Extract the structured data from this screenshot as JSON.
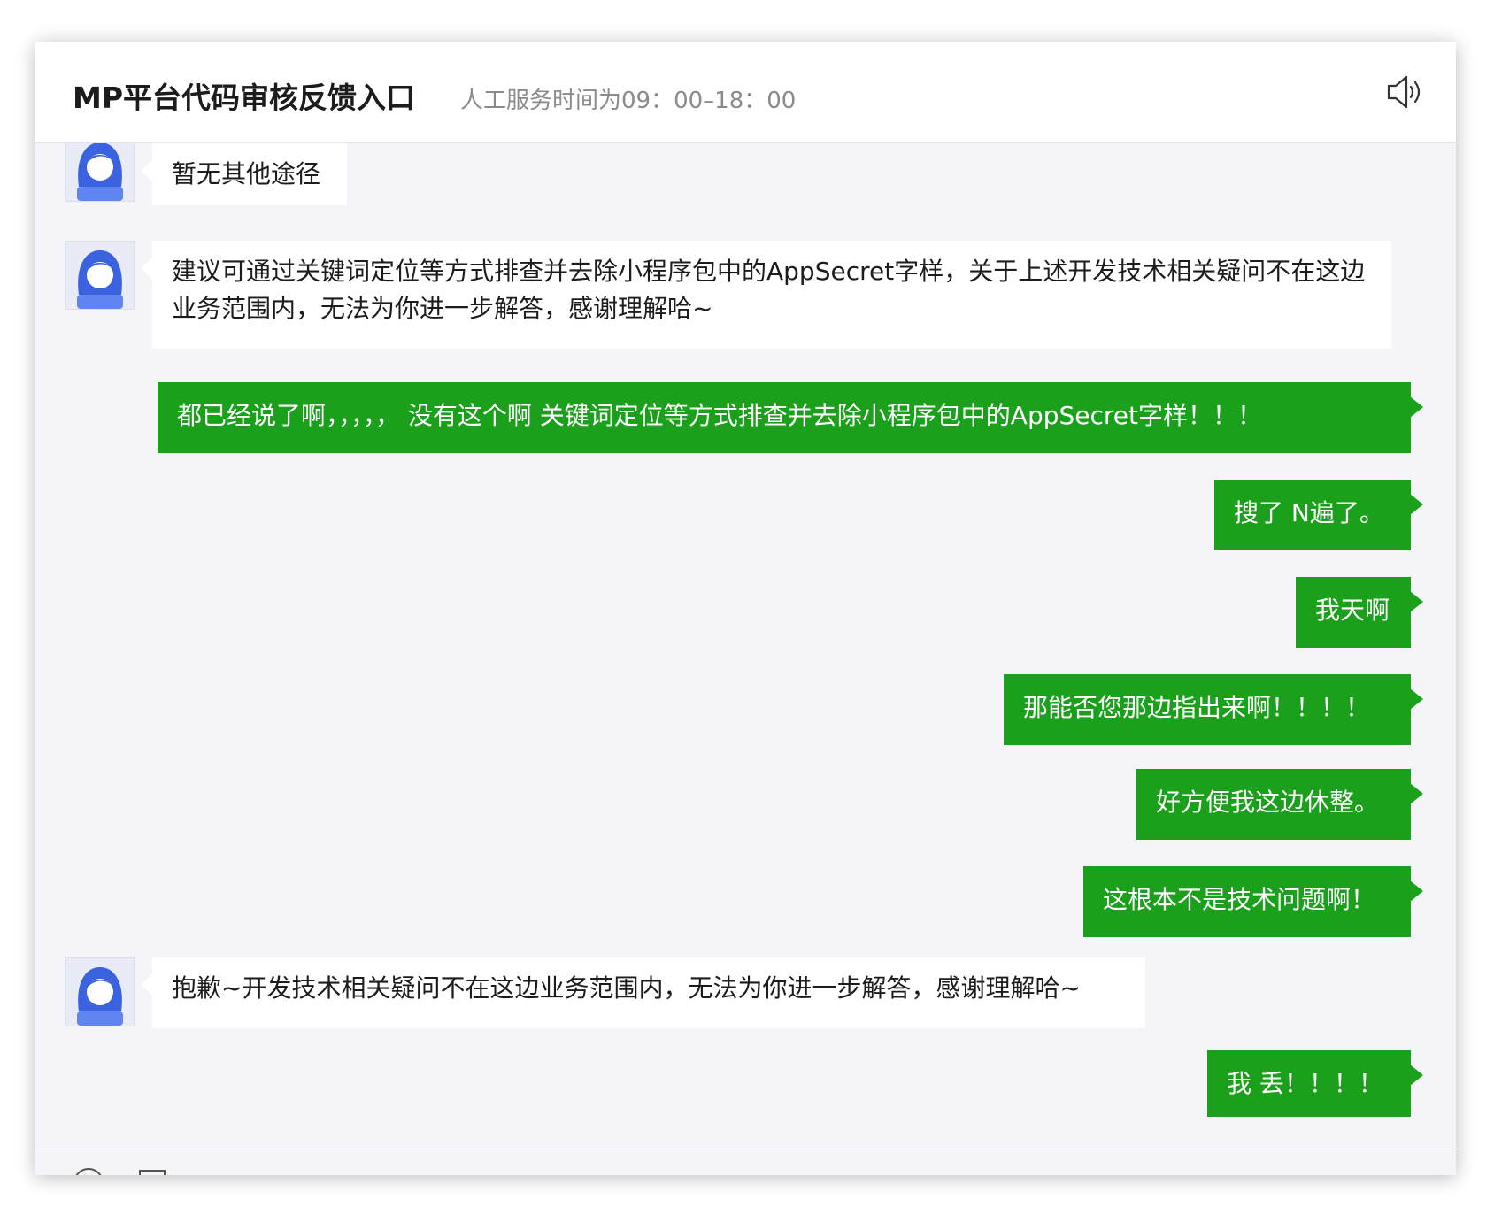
{
  "header": {
    "title": "MP平台代码审核反馈入口",
    "hours": "人工服务时间为09：00–18：00",
    "speaker_icon": "speaker-icon"
  },
  "colors": {
    "outgoing_bubble": "#1aa01a",
    "incoming_bubble": "#ffffff",
    "chat_background": "#f5f5f9"
  },
  "messages": [
    {
      "from": "agent",
      "text": "暂无其他途径"
    },
    {
      "from": "agent",
      "text": "建议可通过关键词定位等方式排查并去除小程序包中的AppSecret字样，关于上述开发技术相关疑问不在这边业务范围内，无法为你进一步解答，感谢理解哈~"
    },
    {
      "from": "user",
      "text": "都已经说了啊，，，，，  没有这个啊 关键词定位等方式排查并去除小程序包中的AppSecret字样！！！"
    },
    {
      "from": "user",
      "text": "搜了 N遍了。"
    },
    {
      "from": "user",
      "text": "我天啊"
    },
    {
      "from": "user",
      "text": "那能否您那边指出来啊！！！！"
    },
    {
      "from": "user",
      "text": "好方便我这边休整。"
    },
    {
      "from": "user",
      "text": "这根本不是技术问题啊！"
    },
    {
      "from": "agent",
      "text": "抱歉~开发技术相关疑问不在这边业务范围内，无法为你进一步解答，感谢理解哈~"
    },
    {
      "from": "user",
      "text": "我 丢！！！！"
    }
  ],
  "footer": {
    "tools": [
      "emoji-icon",
      "folder-icon"
    ]
  }
}
